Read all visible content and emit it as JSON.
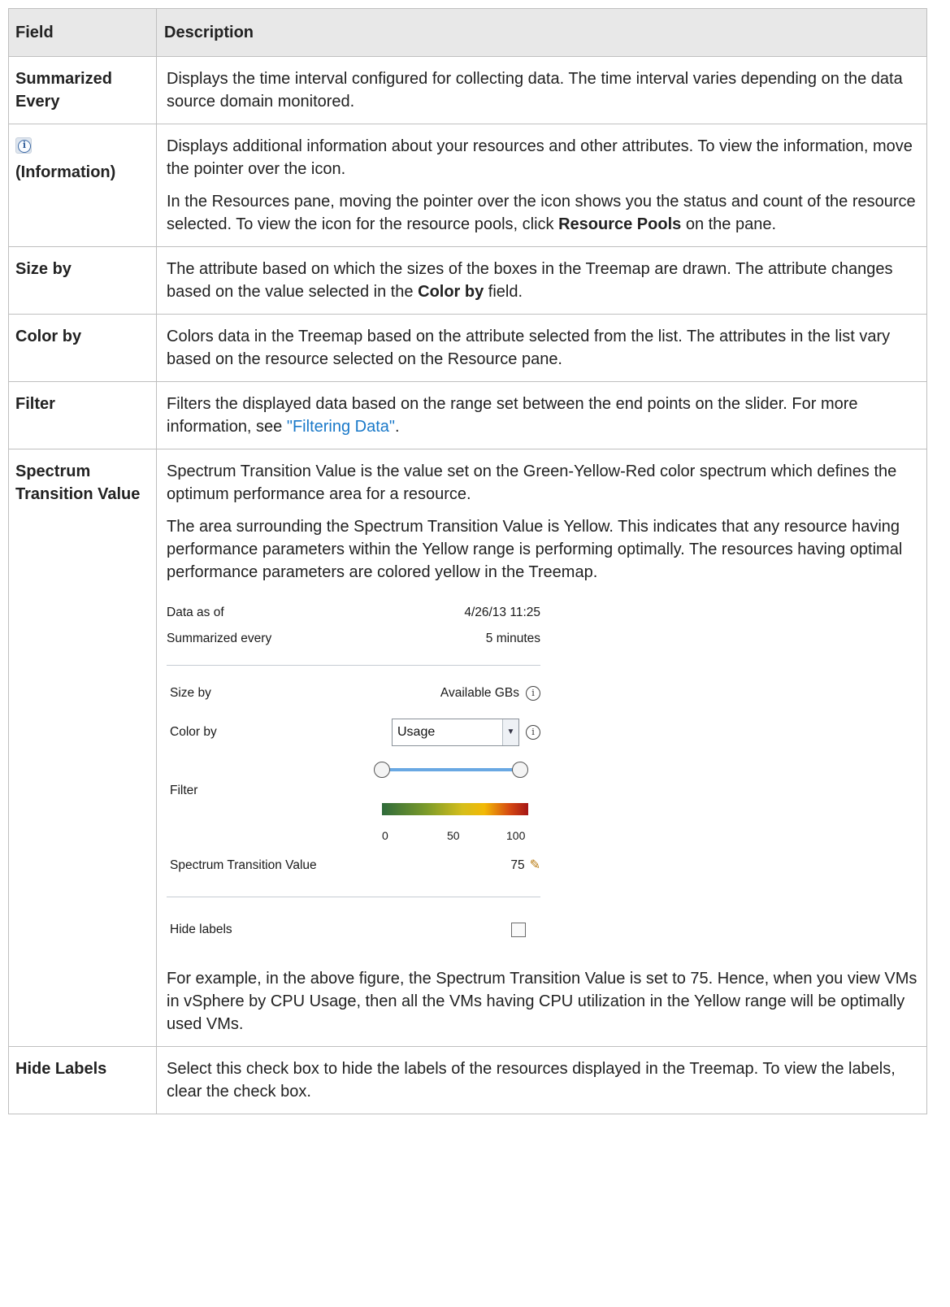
{
  "table": {
    "headers": {
      "field": "Field",
      "description": "Description"
    },
    "rows": {
      "summarized": {
        "field": "Summarized Every",
        "description": "Displays the time interval configured for collecting data. The time interval varies depending on the data source domain monitored."
      },
      "information": {
        "field": "(Information)",
        "p1": "Displays additional information about your resources and other attributes. To view the information, move the pointer over the icon.",
        "p2_before": "In the Resources pane, moving the pointer over the icon shows you the status and count of the resource selected. To view the icon for the resource pools, click ",
        "p2_bold": "Resource Pools",
        "p2_after": " on the pane."
      },
      "size_by": {
        "field": "Size by",
        "before": "The attribute based on which the sizes of the boxes in the Treemap are drawn. The attribute changes based on the value selected in the ",
        "bold": "Color by",
        "after": " field."
      },
      "color_by": {
        "field": "Color by",
        "description": "Colors data in the Treemap based on the attribute selected from the list. The attributes in the list vary based on the resource selected on the Resource pane."
      },
      "filter": {
        "field": "Filter",
        "before": "Filters the displayed data based on the range set between the end points on the slider. For more information, see ",
        "link": "\"Filtering Data\"",
        "after": "."
      },
      "spectrum": {
        "field": "Spectrum Transition Value",
        "p1": "Spectrum Transition Value is the value set on the Green-Yellow-Red color spectrum which defines the optimum performance area for a resource.",
        "p2": "The area surrounding the Spectrum Transition Value is Yellow. This indicates that any resource having performance parameters within the Yellow range is performing optimally. The resources having optimal performance parameters are colored yellow in the Treemap.",
        "p3": "For example, in the above figure, the Spectrum Transition Value is set to 75. Hence, when you view VMs in vSphere by CPU Usage, then all the VMs having CPU utilization in the Yellow range will be optimally used VMs."
      },
      "hide_labels": {
        "field": "Hide Labels",
        "description": "Select this check box to hide the labels of the resources displayed in the Treemap. To view the labels, clear the check box."
      }
    }
  },
  "figure": {
    "data_as_of_label": "Data as of",
    "data_as_of_value": "4/26/13 11:25",
    "summarized_label": "Summarized every",
    "summarized_value": "5 minutes",
    "size_by_label": "Size by",
    "size_by_value": "Available GBs",
    "color_by_label": "Color by",
    "color_by_value": "Usage",
    "filter_label": "Filter",
    "filter_low": 0,
    "filter_high": 100,
    "ticks": [
      "0",
      "50",
      "100"
    ],
    "stv_label": "Spectrum Transition Value",
    "stv_value": "75",
    "hide_labels_label": "Hide labels",
    "hide_labels_checked": false,
    "gradient_colors": [
      "#2f6b3b",
      "#d5be1b",
      "#f2b905",
      "#a51515"
    ],
    "icons": {
      "info": "info-circle-icon",
      "dropdown": "chevron-down-icon",
      "edit": "pencil-icon"
    }
  }
}
